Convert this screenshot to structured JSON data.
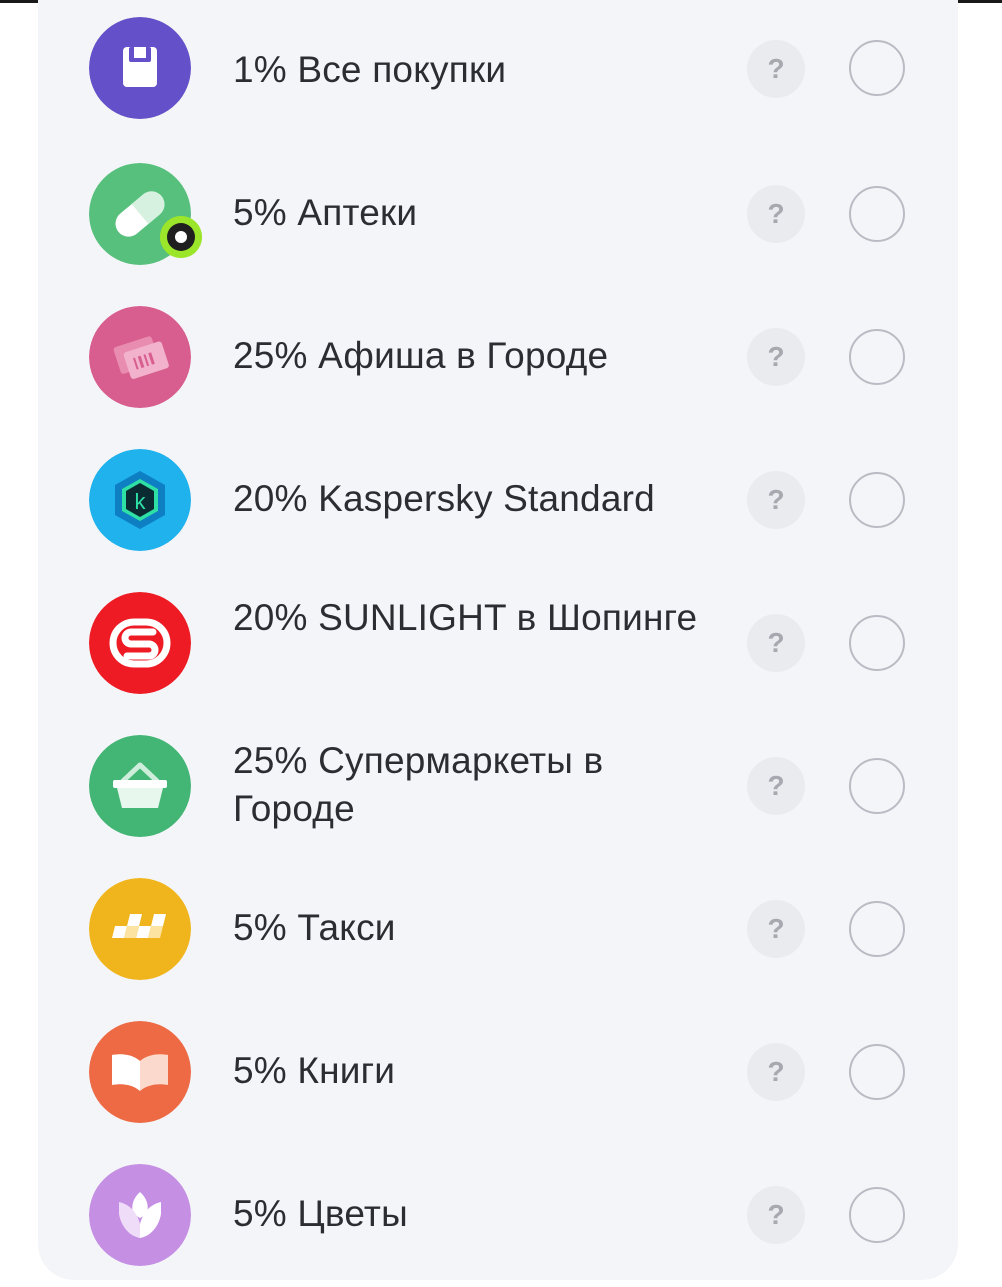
{
  "cashback_categories": {
    "items": [
      {
        "id": "all",
        "label": "1% Все покупки",
        "icon": "shopping-bag-icon",
        "icon_color": "#6450c8"
      },
      {
        "id": "pharmacy",
        "label": "5% Аптеки",
        "icon": "pill-icon",
        "icon_color": "#56c07c",
        "has_badge": true
      },
      {
        "id": "afisha",
        "label": "25% Афиша в Городе",
        "icon": "tickets-icon",
        "icon_color": "#d75e8f"
      },
      {
        "id": "kaspersky",
        "label": "20% Kaspersky Standard",
        "icon": "kaspersky-icon",
        "icon_color": "#1fb2ec"
      },
      {
        "id": "sunlight",
        "label": "20% SUNLIGHT в Шопинге",
        "icon": "sunlight-icon",
        "icon_color": "#ee1b24"
      },
      {
        "id": "supermarkets",
        "label": "25% Супермаркеты в Городе",
        "icon": "basket-icon",
        "icon_color": "#43b574"
      },
      {
        "id": "taxi",
        "label": "5% Такси",
        "icon": "taxi-checker-icon",
        "icon_color": "#f0b51d"
      },
      {
        "id": "books",
        "label": "5% Книги",
        "icon": "open-book-icon",
        "icon_color": "#ee6a44"
      },
      {
        "id": "flowers",
        "label": "5% Цветы",
        "icon": "tulip-icon",
        "icon_color": "#c58fe4"
      }
    ],
    "help_label": "?"
  }
}
